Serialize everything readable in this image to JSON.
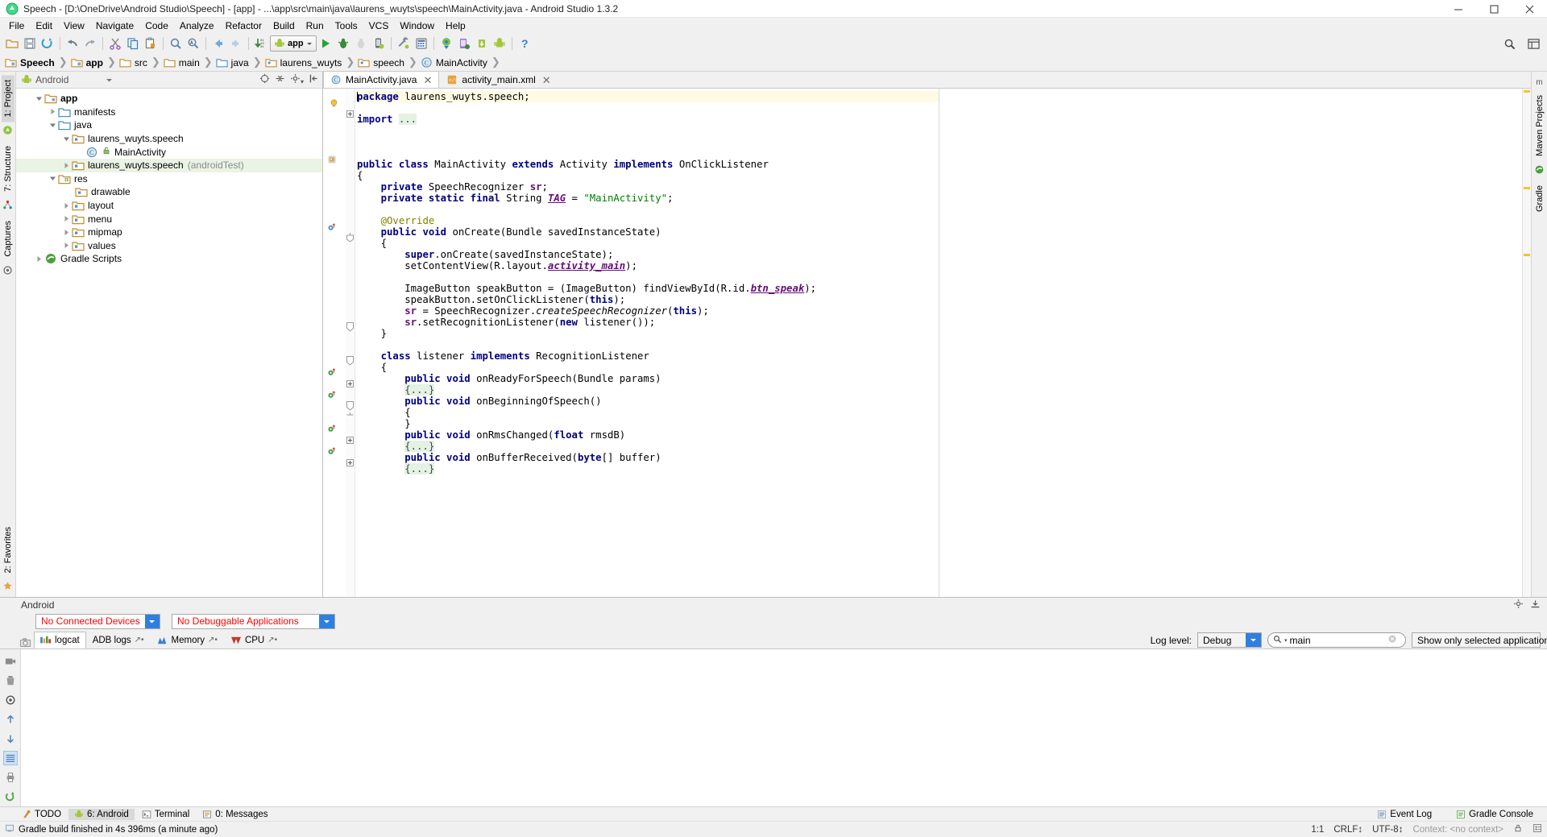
{
  "window": {
    "title": "Speech - [D:\\OneDrive\\Android Studio\\Speech] - [app] - ...\\app\\src\\main\\java\\laurens_wuyts\\speech\\MainActivity.java - Android Studio 1.3.2",
    "minimize_label": "Minimize",
    "maximize_label": "Maximize",
    "close_label": "Close"
  },
  "menu": {
    "items": [
      "File",
      "Edit",
      "View",
      "Navigate",
      "Code",
      "Analyze",
      "Refactor",
      "Build",
      "Run",
      "Tools",
      "VCS",
      "Window",
      "Help"
    ]
  },
  "toolbar": {
    "run_config_label": "app",
    "buttons": [
      "open-folder-icon",
      "save-all-icon",
      "sync-icon",
      "undo-icon",
      "redo-icon",
      "cut-icon",
      "copy-icon",
      "paste-icon",
      "find-icon",
      "replace-icon",
      "back-icon",
      "forward-icon",
      "compile-icon",
      "run-icon",
      "debug-icon",
      "attach-debugger-icon",
      "android-monitor-icon",
      "sdk-manager-icon",
      "avd-manager-icon",
      "gradle-sync-icon",
      "project-structure-icon",
      "sdk-update-icon",
      "android-device-icon",
      "help-icon"
    ],
    "right_buttons": [
      "search-everywhere-icon",
      "layout-icon"
    ]
  },
  "breadcrumb": {
    "items": [
      {
        "label": "Speech",
        "icon": "module-folder-icon",
        "bold": true
      },
      {
        "label": "app",
        "icon": "module-folder-icon",
        "bold": true
      },
      {
        "label": "src",
        "icon": "folder-icon",
        "bold": false
      },
      {
        "label": "main",
        "icon": "folder-icon",
        "bold": false
      },
      {
        "label": "java",
        "icon": "source-folder-icon",
        "bold": false
      },
      {
        "label": "laurens_wuyts",
        "icon": "package-icon",
        "bold": false
      },
      {
        "label": "speech",
        "icon": "package-icon",
        "bold": false
      },
      {
        "label": "MainActivity",
        "icon": "class-icon",
        "bold": false
      }
    ]
  },
  "left_strip": {
    "tabs": [
      "1: Project",
      "7: Structure",
      "Captures",
      "2: Favorites"
    ],
    "selected": "1: Project"
  },
  "right_strip": {
    "tabs": [
      "Maven Projects",
      "Gradle"
    ]
  },
  "project_panel": {
    "view_selector": "Android",
    "actions": [
      "target-icon",
      "collapse-all-icon",
      "settings-icon",
      "hide-icon"
    ],
    "tree": [
      {
        "label": "app",
        "icon": "module-icon",
        "depth": 0,
        "arrow": "open",
        "bold": true,
        "dim": ""
      },
      {
        "label": "manifests",
        "icon": "folder-blue-icon",
        "depth": 1,
        "arrow": "closed",
        "bold": false,
        "dim": ""
      },
      {
        "label": "java",
        "icon": "folder-blue-icon",
        "depth": 1,
        "arrow": "open",
        "bold": false,
        "dim": ""
      },
      {
        "label": "laurens_wuyts.speech",
        "icon": "package-icon",
        "depth": 2,
        "arrow": "open",
        "bold": false,
        "dim": ""
      },
      {
        "label": "MainActivity",
        "icon": "class-icon",
        "depth": 3,
        "arrow": "none",
        "bold": false,
        "dim": ""
      },
      {
        "label": "laurens_wuyts.speech",
        "icon": "package-icon",
        "depth": 2,
        "arrow": "closed",
        "bold": false,
        "dim": "(androidTest)",
        "highlight": true
      },
      {
        "label": "res",
        "icon": "res-folder-icon",
        "depth": 1,
        "arrow": "open",
        "bold": false,
        "dim": ""
      },
      {
        "label": "drawable",
        "icon": "package-icon",
        "depth": 2,
        "arrow": "none",
        "bold": false,
        "dim": ""
      },
      {
        "label": "layout",
        "icon": "package-icon",
        "depth": 2,
        "arrow": "closed",
        "bold": false,
        "dim": ""
      },
      {
        "label": "menu",
        "icon": "package-icon",
        "depth": 2,
        "arrow": "closed",
        "bold": false,
        "dim": ""
      },
      {
        "label": "mipmap",
        "icon": "package-icon",
        "depth": 2,
        "arrow": "closed",
        "bold": false,
        "dim": ""
      },
      {
        "label": "values",
        "icon": "package-icon",
        "depth": 2,
        "arrow": "closed",
        "bold": false,
        "dim": ""
      },
      {
        "label": "Gradle Scripts",
        "icon": "gradle-icon",
        "depth": 0,
        "arrow": "closed",
        "bold": false,
        "dim": ""
      }
    ]
  },
  "editor": {
    "tabs": [
      {
        "label": "MainActivity.java",
        "icon": "class-icon",
        "active": true
      },
      {
        "label": "activity_main.xml",
        "icon": "xml-icon",
        "active": false
      }
    ],
    "code_lines": [
      "package laurens_wuyts.speech;",
      "",
      "import ...",
      "",
      "",
      "public class MainActivity extends Activity implements OnClickListener",
      "{",
      "    private SpeechRecognizer sr;",
      "    private static final String TAG = \"MainActivity\";",
      "",
      "    @Override",
      "    public void onCreate(Bundle savedInstanceState)",
      "    {",
      "        super.onCreate(savedInstanceState);",
      "        setContentView(R.layout.activity_main);",
      "",
      "        ImageButton speakButton = (ImageButton) findViewById(R.id.btn_speak);",
      "        speakButton.setOnClickListener(this);",
      "        sr = SpeechRecognizer.createSpeechRecognizer(this);",
      "        sr.setRecognitionListener(new listener());",
      "    }",
      "",
      "    class listener implements RecognitionListener",
      "    {",
      "        public void onReadyForSpeech(Bundle params)",
      "        {...}",
      "        public void onBeginningOfSpeech()",
      "        {",
      "        }",
      "        public void onRmsChanged(float rmsdB)",
      "        {...}",
      "        public void onBufferReceived(byte[] buffer)",
      "        {...}"
    ]
  },
  "android_panel": {
    "title": "Android",
    "device_selector": "No Connected Devices",
    "app_selector": "No Debuggable Applications",
    "tabs": [
      {
        "label": "logcat",
        "icon": "logcat-icon",
        "active": true,
        "detach": false
      },
      {
        "label": "ADB logs",
        "icon": "",
        "active": false,
        "detach": true
      },
      {
        "label": "Memory",
        "icon": "memory-icon",
        "active": false,
        "detach": true
      },
      {
        "label": "CPU",
        "icon": "cpu-icon",
        "active": false,
        "detach": true
      }
    ],
    "log_level_label": "Log level:",
    "log_level_value": "Debug",
    "search_value": "main",
    "search_placeholder": "",
    "filter_value": "Show only selected application",
    "side_tools": [
      "screenshot-icon",
      "screen-record-icon",
      "clear-logcat-icon",
      "gc-icon",
      "dump-heap-icon",
      "scroll-up-icon",
      "scroll-down-icon",
      "scroll-end-icon",
      "print-icon",
      "restart-icon"
    ]
  },
  "tool_window_bar": {
    "left": [
      {
        "label": "TODO",
        "icon": "todo-icon",
        "selected": false
      },
      {
        "label": "6: Android",
        "icon": "android-icon",
        "selected": true
      },
      {
        "label": "Terminal",
        "icon": "terminal-icon",
        "selected": false
      },
      {
        "label": "0: Messages",
        "icon": "messages-icon",
        "selected": false
      }
    ],
    "right": [
      {
        "label": "Event Log",
        "icon": "event-log-icon"
      },
      {
        "label": "Gradle Console",
        "icon": "gradle-console-icon"
      }
    ]
  },
  "status_bar": {
    "message": "Gradle build finished in 4s 396ms (a minute ago)",
    "caret_position": "1:1",
    "line_separator": "CRLF↕",
    "encoding": "UTF-8↕",
    "context": "Context: <no context>",
    "lock_icon": "lock-icon",
    "inspection_icon": "inspection-icon"
  },
  "colors": {
    "accent_blue": "#2f7fe0",
    "keyword": "#000080",
    "string": "#008000",
    "field": "#660e7a",
    "annotation": "#808000",
    "error_red": "#ff0000",
    "highlight_green": "#eaf4e5",
    "caret_line": "#fffae3"
  }
}
